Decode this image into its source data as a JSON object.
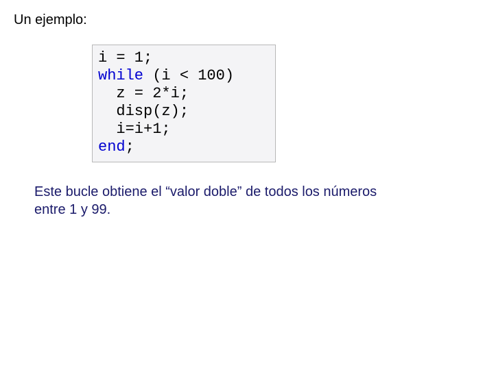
{
  "heading": "Un ejemplo:",
  "code": {
    "l1": "i = 1;",
    "l2_kw": "while",
    "l2_rest": " (i < 100)",
    "l3": "  z = 2*i;",
    "l4": "  disp(z);",
    "l5": "  i=i+1;",
    "l6_kw": "end",
    "l6_rest": ";"
  },
  "caption": " Este bucle obtiene el “valor doble” de todos los números entre 1 y 99."
}
